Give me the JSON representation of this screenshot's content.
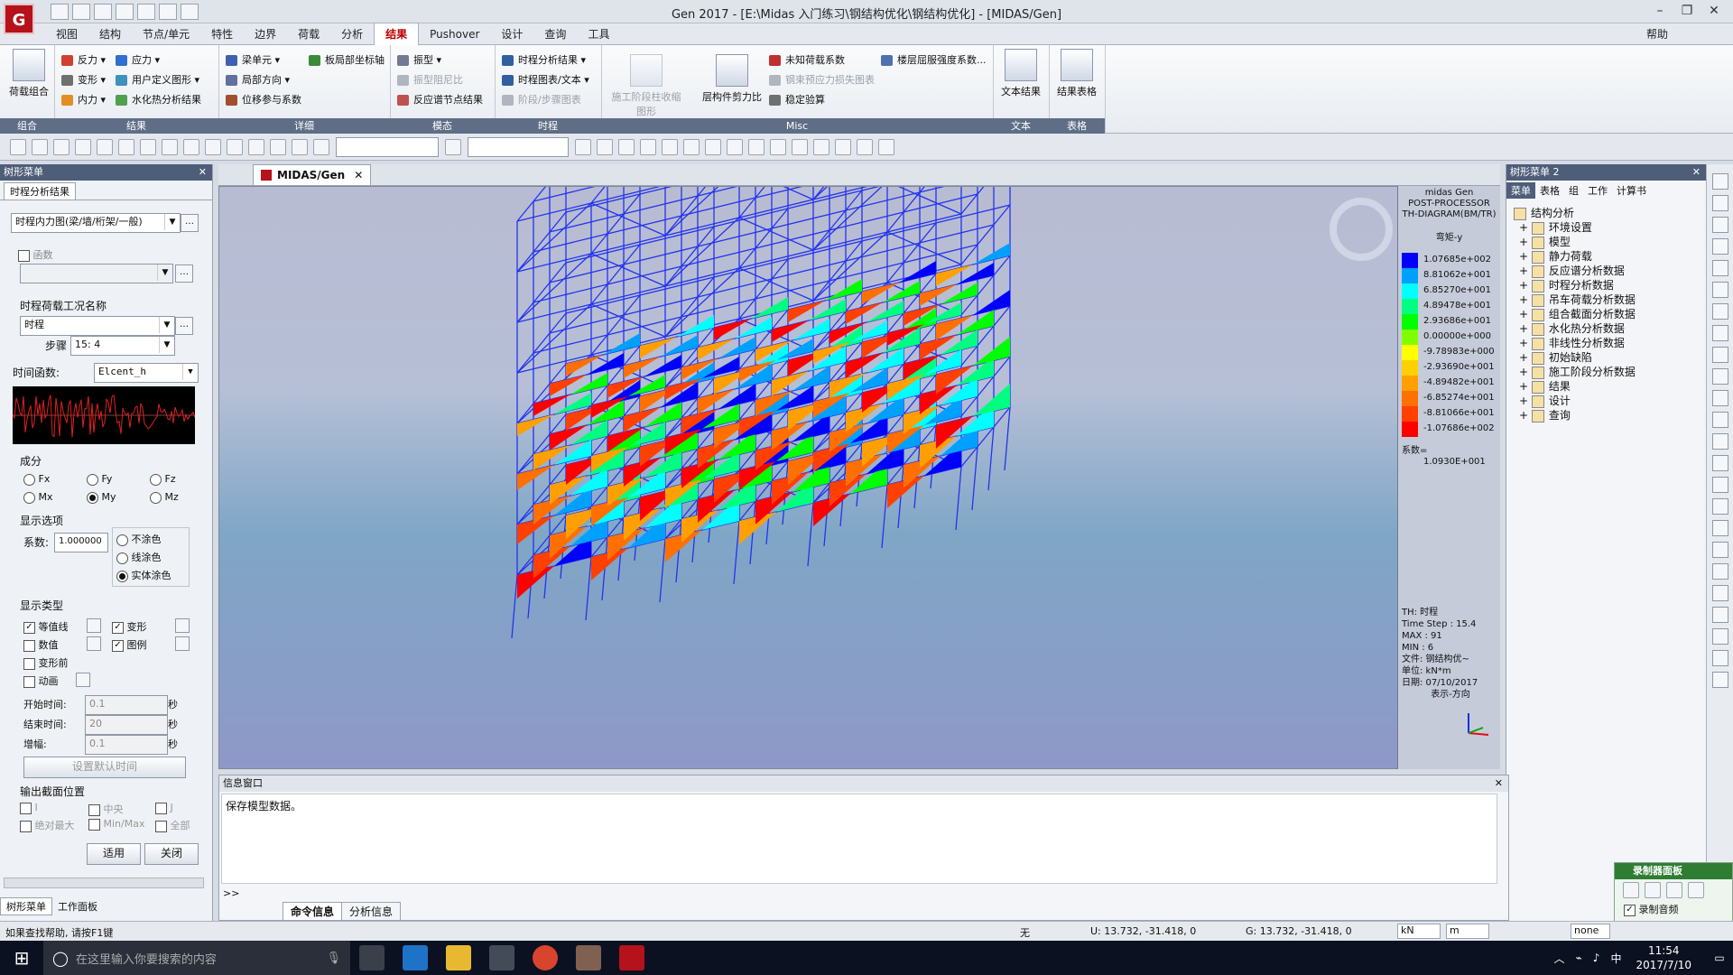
{
  "window": {
    "title": "Gen 2017 - [E:\\Midas 入门练习\\钢结构优化\\钢结构优化] - [MIDAS/Gen]",
    "logo_text": "G"
  },
  "menu": {
    "tabs": [
      "视图",
      "结构",
      "节点/单元",
      "特性",
      "边界",
      "荷载",
      "分析",
      "结果",
      "Pushover",
      "设计",
      "查询",
      "工具"
    ],
    "active": "结果",
    "help": "帮助"
  },
  "ribbon": {
    "groups": [
      {
        "label": "组合",
        "items": [
          "荷载组合"
        ]
      },
      {
        "label": "结果",
        "items": [
          "反力",
          "应力",
          "变形",
          "用户定义图形",
          "内力",
          "水化热分析结果"
        ]
      },
      {
        "label": "详细",
        "items": [
          "梁单元",
          "局部方向",
          "位移参与系数",
          "板局部坐标轴"
        ]
      },
      {
        "label": "模态",
        "items": [
          "振型",
          "振型阻尼比",
          "反应谱节点结果"
        ]
      },
      {
        "label": "时程",
        "items": [
          "时程分析结果",
          "时程图表/文本",
          "阶段/步骤图表"
        ]
      },
      {
        "label": "Misc",
        "items": [
          "施工阶段柱收缩图形",
          "层构件剪力比",
          "未知荷载系数",
          "钢束预应力损失图表",
          "稳定验算",
          "楼层屈服强度系数..."
        ]
      },
      {
        "label": "文本",
        "items": [
          "文本结果"
        ]
      },
      {
        "label": "表格",
        "items": [
          "结果表格"
        ]
      }
    ]
  },
  "left_panel": {
    "title": "树形菜单",
    "tab": "时程分析结果",
    "result_type": "时程内力图(梁/墙/桁架/一般)",
    "function_label": "函数",
    "load_case_title": "时程荷载工况名称",
    "load_case": "时程",
    "step_label": "步骤",
    "step_value": "15: 4",
    "time_func_label": "时间函数:",
    "time_func": "Elcent_h",
    "component_label": "成分",
    "components": [
      "Fx",
      "Fy",
      "Fz",
      "Mx",
      "My",
      "Mz"
    ],
    "component_selected": "My",
    "display_options_label": "显示选项",
    "factor_label": "系数:",
    "factor_value": "1.000000",
    "fill_options": [
      "不涂色",
      "线涂色",
      "实体涂色"
    ],
    "fill_selected": "实体涂色",
    "display_type_label": "显示类型",
    "display_types": [
      {
        "label": "等值线",
        "checked": true
      },
      {
        "label": "变形",
        "checked": true
      },
      {
        "label": "数值",
        "checked": false
      },
      {
        "label": "图例",
        "checked": true
      },
      {
        "label": "变形前",
        "checked": false
      },
      {
        "label": "动画",
        "checked": false
      }
    ],
    "start_time_label": "开始时间:",
    "start_time": "0.1",
    "end_time_label": "结束时间:",
    "end_time": "20",
    "increment_label": "增幅:",
    "increment": "0.1",
    "unit_sec": "秒",
    "set_default_time": "设置默认时间",
    "output_section_label": "输出截面位置",
    "section_options": [
      "I",
      "中央",
      "J",
      "绝对最大",
      "Min/Max",
      "全部"
    ],
    "apply": "适用",
    "close": "关闭",
    "bottom_tabs": [
      "树形菜单",
      "工作面板"
    ]
  },
  "doc_tab": "MIDAS/Gen",
  "legend": {
    "header": [
      "midas Gen",
      "POST-PROCESSOR",
      "TH-DIAGRAM(BM/TR)"
    ],
    "component": "弯矩-y",
    "values": [
      "1.07685e+002",
      "8.81062e+001",
      "6.85270e+001",
      "4.89478e+001",
      "2.93686e+001",
      "0.00000e+000",
      "-9.78983e+000",
      "-2.93690e+001",
      "-4.89482e+001",
      "-6.85274e+001",
      "-8.81066e+001",
      "-1.07686e+002"
    ],
    "colors": [
      "#0000ff",
      "#00a0ff",
      "#00ffff",
      "#00ff80",
      "#00ff00",
      "#80ff00",
      "#ffff00",
      "#ffd000",
      "#ffa000",
      "#ff7000",
      "#ff4000",
      "#ff0000"
    ],
    "coef_label": "系数=",
    "coef_value": "1.0930E+001",
    "info": [
      "TH: 时程",
      "Time Step : 15.4",
      "MAX : 91",
      "MIN : 6",
      "文件: 钢结构优~",
      "单位: kN*m",
      "日期: 07/10/2017",
      "表示-方向"
    ]
  },
  "right_panel": {
    "title": "树形菜单 2",
    "tabs": [
      "菜单",
      "表格",
      "组",
      "工作",
      "计算书"
    ],
    "tree": [
      "结构分析",
      "环境设置",
      "模型",
      "静力荷载",
      "反应谱分析数据",
      "时程分析数据",
      "吊车荷载分析数据",
      "组合截面分析数据",
      "水化热分析数据",
      "非线性分析数据",
      "初始缺陷",
      "施工阶段分析数据",
      "结果",
      "设计",
      "查询"
    ]
  },
  "message_window": {
    "title": "信息窗口",
    "text": "保存模型数据。",
    "prompt": ">>",
    "tabs": [
      "命令信息",
      "分析信息"
    ]
  },
  "status": {
    "help": "如果查找帮助, 请按F1键",
    "snap": "无",
    "u_coord": "U: 13.732, -31.418, 0",
    "g_coord": "G: 13.732, -31.418, 0",
    "unit_force": "kN",
    "unit_len": "m",
    "mode": "none"
  },
  "recorder": {
    "title": "录制器面板",
    "checkbox": "录制音频"
  },
  "taskbar": {
    "search_placeholder": "在这里输入你要搜索的内容",
    "time": "11:54",
    "date": "2017/7/10",
    "ime": "中"
  },
  "colors": {
    "accent": "#b00000",
    "frame_blue": "#2233ee",
    "panel_header": "#4e5d78"
  }
}
